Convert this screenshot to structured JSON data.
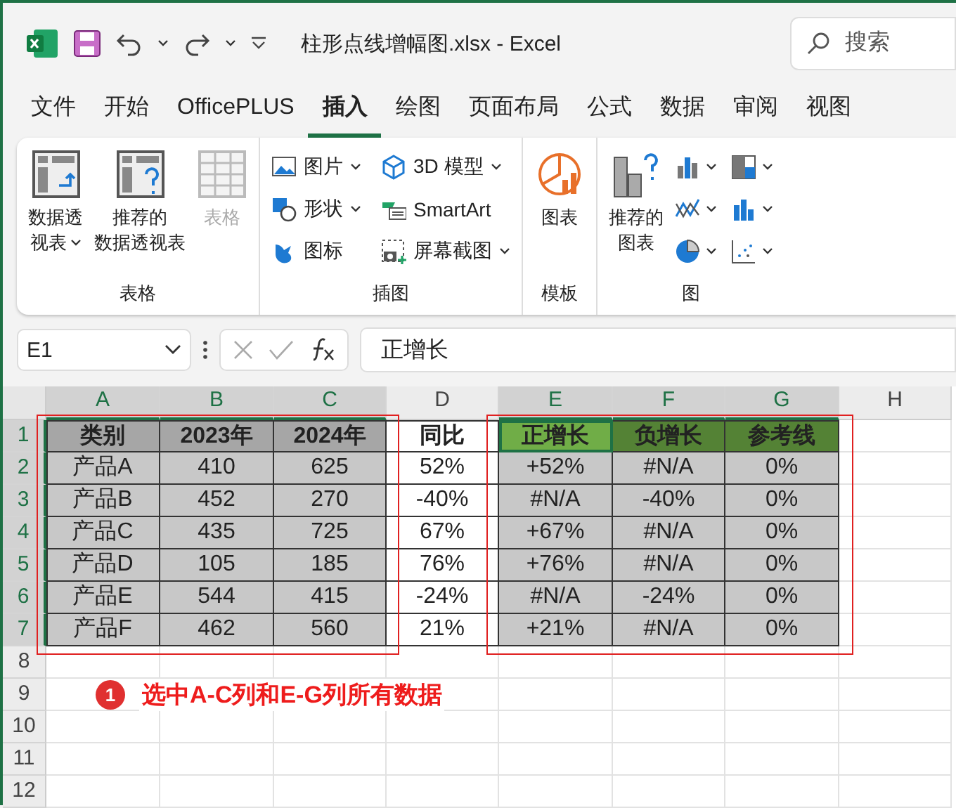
{
  "title_bar": {
    "title": "柱形点线增幅图.xlsx  -  Excel",
    "search": {
      "placeholder": "搜索"
    }
  },
  "menu_tabs": [
    {
      "label": "文件",
      "selected": false
    },
    {
      "label": "开始",
      "selected": false
    },
    {
      "label": "OfficePLUS",
      "selected": false
    },
    {
      "label": "插入",
      "selected": true
    },
    {
      "label": "绘图",
      "selected": false
    },
    {
      "label": "页面布局",
      "selected": false
    },
    {
      "label": "公式",
      "selected": false
    },
    {
      "label": "数据",
      "selected": false
    },
    {
      "label": "审阅",
      "selected": false
    },
    {
      "label": "视图",
      "selected": false
    }
  ],
  "ribbon": [
    {
      "label": "表格",
      "items": [
        {
          "kind": "large",
          "lines": [
            "数据透",
            "视表"
          ],
          "dropdown": true,
          "disabled": false
        },
        {
          "kind": "large",
          "lines": [
            "推荐的",
            "数据透视表"
          ],
          "dropdown": false,
          "disabled": false
        },
        {
          "kind": "large",
          "lines": [
            "表格"
          ],
          "dropdown": false,
          "disabled": true
        }
      ]
    },
    {
      "label": "插图",
      "items": [
        {
          "kind": "small",
          "lines": [
            "图片"
          ],
          "dropdown": true,
          "disabled": false
        },
        {
          "kind": "small",
          "lines": [
            "形状"
          ],
          "dropdown": true,
          "disabled": false
        },
        {
          "kind": "small",
          "lines": [
            "图标"
          ],
          "dropdown": false,
          "disabled": false
        },
        {
          "kind": "small",
          "lines": [
            "3D 模型"
          ],
          "dropdown": true,
          "disabled": false
        },
        {
          "kind": "small",
          "lines": [
            "SmartArt"
          ],
          "dropdown": false,
          "disabled": false
        },
        {
          "kind": "small",
          "lines": [
            "屏幕截图"
          ],
          "dropdown": true,
          "disabled": false
        }
      ]
    },
    {
      "label": "模板",
      "items": [
        {
          "kind": "large",
          "lines": [
            "图表"
          ],
          "dropdown": false,
          "disabled": false
        }
      ]
    },
    {
      "label": "图",
      "items": [
        {
          "kind": "large",
          "lines": [
            "推荐的",
            "图表"
          ],
          "dropdown": false,
          "disabled": false
        },
        {
          "kind": "icon",
          "dropdown": true,
          "disabled": false
        },
        {
          "kind": "icon",
          "dropdown": true,
          "disabled": false
        },
        {
          "kind": "icon",
          "dropdown": true,
          "disabled": false
        },
        {
          "kind": "icon",
          "dropdown": true,
          "disabled": false
        },
        {
          "kind": "icon",
          "dropdown": true,
          "disabled": false
        },
        {
          "kind": "icon",
          "dropdown": true,
          "disabled": false
        }
      ]
    }
  ],
  "formula_bar": {
    "name_box": "E1",
    "formula": "正增长"
  },
  "grid": {
    "columns": [
      {
        "label": "A",
        "selected": true
      },
      {
        "label": "B",
        "selected": true
      },
      {
        "label": "C",
        "selected": true
      },
      {
        "label": "D",
        "selected": false
      },
      {
        "label": "E",
        "selected": true
      },
      {
        "label": "F",
        "selected": true
      },
      {
        "label": "G",
        "selected": true
      },
      {
        "label": "H",
        "selected": false
      }
    ],
    "rows": [
      {
        "number": "1",
        "selected": true,
        "kind": "header",
        "cells": [
          {
            "text": "类别",
            "color": "#a6a6a6",
            "active": false
          },
          {
            "text": "2023年",
            "color": "#a6a6a6",
            "active": false
          },
          {
            "text": "2024年",
            "color": "#a6a6a6",
            "active": false
          },
          {
            "text": "同比",
            "color": "#ffffff",
            "active": false
          },
          {
            "text": "正增长",
            "color": "#70ad47",
            "active": true
          },
          {
            "text": "负增长",
            "color": "#548235",
            "active": false
          },
          {
            "text": "参考线",
            "color": "#548235",
            "active": false
          }
        ]
      },
      {
        "number": "2",
        "selected": true,
        "kind": "data",
        "cells": [
          {
            "text": "产品A",
            "color": "#c8c8c8",
            "active": false
          },
          {
            "text": "410",
            "color": "#c8c8c8",
            "active": false
          },
          {
            "text": "625",
            "color": "#c8c8c8",
            "active": false
          },
          {
            "text": "52%",
            "color": "#ffffff",
            "active": false
          },
          {
            "text": "+52%",
            "color": "#c8c8c8",
            "active": false
          },
          {
            "text": "#N/A",
            "color": "#c8c8c8",
            "active": false
          },
          {
            "text": "0%",
            "color": "#c8c8c8",
            "active": false
          }
        ]
      },
      {
        "number": "3",
        "selected": true,
        "kind": "data",
        "cells": [
          {
            "text": "产品B",
            "color": "#c8c8c8",
            "active": false
          },
          {
            "text": "452",
            "color": "#c8c8c8",
            "active": false
          },
          {
            "text": "270",
            "color": "#c8c8c8",
            "active": false
          },
          {
            "text": "-40%",
            "color": "#ffffff",
            "active": false
          },
          {
            "text": "#N/A",
            "color": "#c8c8c8",
            "active": false
          },
          {
            "text": "-40%",
            "color": "#c8c8c8",
            "active": false
          },
          {
            "text": "0%",
            "color": "#c8c8c8",
            "active": false
          }
        ]
      },
      {
        "number": "4",
        "selected": true,
        "kind": "data",
        "cells": [
          {
            "text": "产品C",
            "color": "#c8c8c8",
            "active": false
          },
          {
            "text": "435",
            "color": "#c8c8c8",
            "active": false
          },
          {
            "text": "725",
            "color": "#c8c8c8",
            "active": false
          },
          {
            "text": "67%",
            "color": "#ffffff",
            "active": false
          },
          {
            "text": "+67%",
            "color": "#c8c8c8",
            "active": false
          },
          {
            "text": "#N/A",
            "color": "#c8c8c8",
            "active": false
          },
          {
            "text": "0%",
            "color": "#c8c8c8",
            "active": false
          }
        ]
      },
      {
        "number": "5",
        "selected": true,
        "kind": "data",
        "cells": [
          {
            "text": "产品D",
            "color": "#c8c8c8",
            "active": false
          },
          {
            "text": "105",
            "color": "#c8c8c8",
            "active": false
          },
          {
            "text": "185",
            "color": "#c8c8c8",
            "active": false
          },
          {
            "text": "76%",
            "color": "#ffffff",
            "active": false
          },
          {
            "text": "+76%",
            "color": "#c8c8c8",
            "active": false
          },
          {
            "text": "#N/A",
            "color": "#c8c8c8",
            "active": false
          },
          {
            "text": "0%",
            "color": "#c8c8c8",
            "active": false
          }
        ]
      },
      {
        "number": "6",
        "selected": true,
        "kind": "data",
        "cells": [
          {
            "text": "产品E",
            "color": "#c8c8c8",
            "active": false
          },
          {
            "text": "544",
            "color": "#c8c8c8",
            "active": false
          },
          {
            "text": "415",
            "color": "#c8c8c8",
            "active": false
          },
          {
            "text": "-24%",
            "color": "#ffffff",
            "active": false
          },
          {
            "text": "#N/A",
            "color": "#c8c8c8",
            "active": false
          },
          {
            "text": "-24%",
            "color": "#c8c8c8",
            "active": false
          },
          {
            "text": "0%",
            "color": "#c8c8c8",
            "active": false
          }
        ]
      },
      {
        "number": "7",
        "selected": true,
        "kind": "data",
        "cells": [
          {
            "text": "产品F",
            "color": "#c8c8c8",
            "active": false
          },
          {
            "text": "462",
            "color": "#c8c8c8",
            "active": false
          },
          {
            "text": "560",
            "color": "#c8c8c8",
            "active": false
          },
          {
            "text": "21%",
            "color": "#ffffff",
            "active": false
          },
          {
            "text": "+21%",
            "color": "#c8c8c8",
            "active": false
          },
          {
            "text": "#N/A",
            "color": "#c8c8c8",
            "active": false
          },
          {
            "text": "0%",
            "color": "#c8c8c8",
            "active": false
          }
        ]
      },
      {
        "number": "8",
        "selected": false,
        "kind": "empty",
        "cells": []
      },
      {
        "number": "9",
        "selected": false,
        "kind": "empty",
        "cells": []
      },
      {
        "number": "10",
        "selected": false,
        "kind": "empty",
        "cells": []
      },
      {
        "number": "11",
        "selected": false,
        "kind": "empty",
        "cells": []
      },
      {
        "number": "12",
        "selected": false,
        "kind": "empty",
        "cells": []
      }
    ]
  },
  "annotation": {
    "badge": "1",
    "text": "选中A-C列和E-G列所有数据"
  }
}
